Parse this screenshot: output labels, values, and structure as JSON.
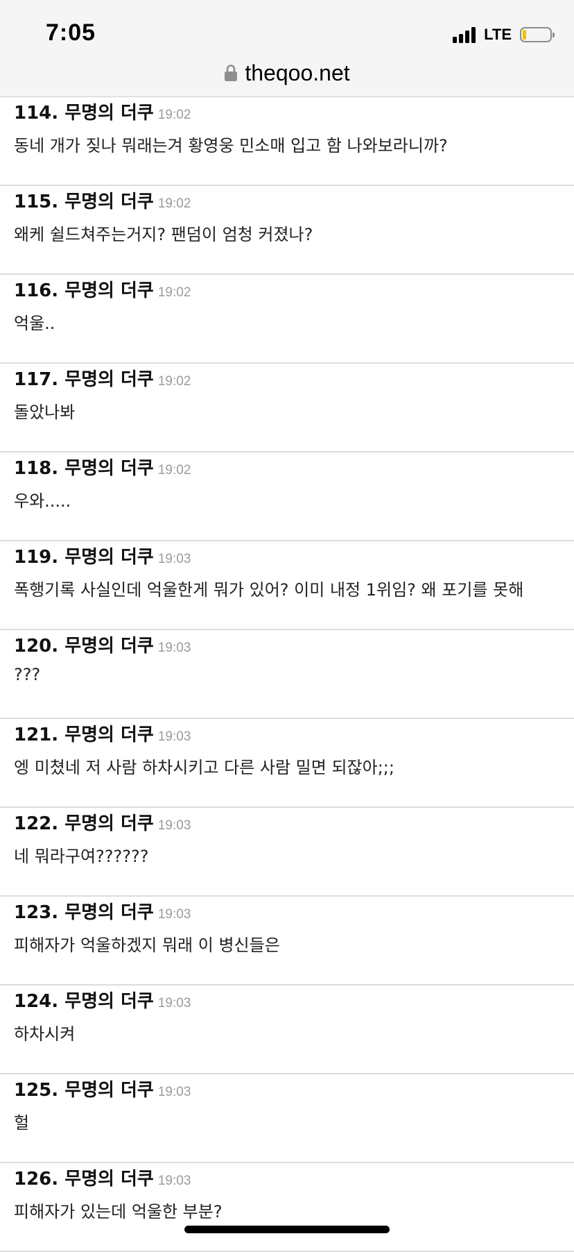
{
  "status_bar": {
    "time": "7:05",
    "network": "LTE",
    "battery_level": 0.12
  },
  "browser": {
    "url": "theqoo.net"
  },
  "comments": [
    {
      "author": "114. 무명의 더쿠",
      "time": "19:02",
      "text": "동네 개가 짖나 뭐래는겨 황영웅 민소매 입고 함 나와보라니까?"
    },
    {
      "author": "115. 무명의 더쿠",
      "time": "19:02",
      "text": "왜케 쉴드쳐주는거지? 팬덤이 엄청 커졌나?"
    },
    {
      "author": "116. 무명의 더쿠",
      "time": "19:02",
      "text": "억울.."
    },
    {
      "author": "117. 무명의 더쿠",
      "time": "19:02",
      "text": "돌았나봐"
    },
    {
      "author": "118. 무명의 더쿠",
      "time": "19:02",
      "text": "우와....."
    },
    {
      "author": "119. 무명의 더쿠",
      "time": "19:03",
      "text": "폭행기록 사실인데 억울한게 뭐가 있어? 이미 내정 1위임? 왜 포기를 못해"
    },
    {
      "author": "120. 무명의 더쿠",
      "time": "19:03",
      "text": "???"
    },
    {
      "author": "121. 무명의 더쿠",
      "time": "19:03",
      "text": "엥 미쳤네 저 사람 하차시키고 다른 사람 밀면 되잖아;;;"
    },
    {
      "author": "122. 무명의 더쿠",
      "time": "19:03",
      "text": "네 뭐라구여??????"
    },
    {
      "author": "123. 무명의 더쿠",
      "time": "19:03",
      "text": "피해자가 억울하겠지 뭐래 이 병신들은"
    },
    {
      "author": "124. 무명의 더쿠",
      "time": "19:03",
      "text": "하차시켜"
    },
    {
      "author": "125. 무명의 더쿠",
      "time": "19:03",
      "text": "헐"
    },
    {
      "author": "126. 무명의 더쿠",
      "time": "19:03",
      "text": "피해자가 있는데 억울한 부분?"
    }
  ]
}
